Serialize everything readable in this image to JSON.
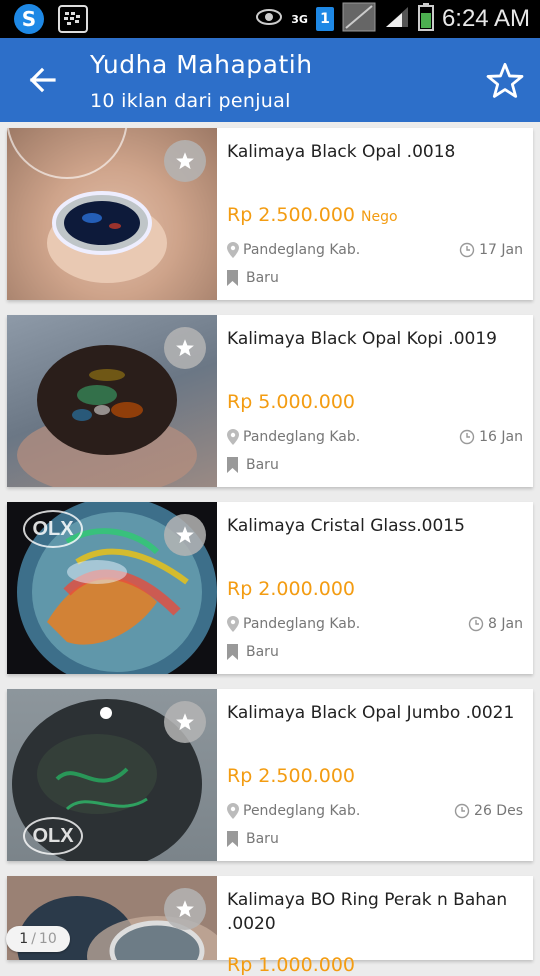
{
  "status_bar": {
    "time": "6:24 AM",
    "network": "3G",
    "sim": "1"
  },
  "app_bar": {
    "title": "Yudha Mahapatih",
    "subtitle": "10 iklan dari penjual"
  },
  "listings": [
    {
      "title": "Kalimaya Black Opal .0018",
      "price": "Rp 2.500.000",
      "nego": "Nego",
      "location": "Pandeglang Kab.",
      "date": "17 Jan",
      "condition": "Baru"
    },
    {
      "title": "Kalimaya Black Opal Kopi .0019",
      "price": "Rp 5.000.000",
      "nego": "",
      "location": "Pandeglang Kab.",
      "date": "16 Jan",
      "condition": "Baru"
    },
    {
      "title": "Kalimaya Cristal Glass.0015",
      "price": "Rp 2.000.000",
      "nego": "",
      "location": "Pandeglang Kab.",
      "date": "8 Jan",
      "condition": "Baru"
    },
    {
      "title": "Kalimaya Black Opal Jumbo .0021",
      "price": "Rp 2.500.000",
      "nego": "",
      "location": "Pendeglang Kab.",
      "date": "26 Des",
      "condition": "Baru"
    },
    {
      "title": "Kalimaya BO Ring Perak n Bahan .0020",
      "price": "Rp 1.000.000",
      "nego": "",
      "location": "",
      "date": "",
      "condition": ""
    }
  ],
  "watermark": "OLX",
  "pager": {
    "current": "1",
    "separator": "/",
    "total": "10"
  },
  "colors": {
    "appbar": "#2d6fc9",
    "price": "#f39c12"
  }
}
